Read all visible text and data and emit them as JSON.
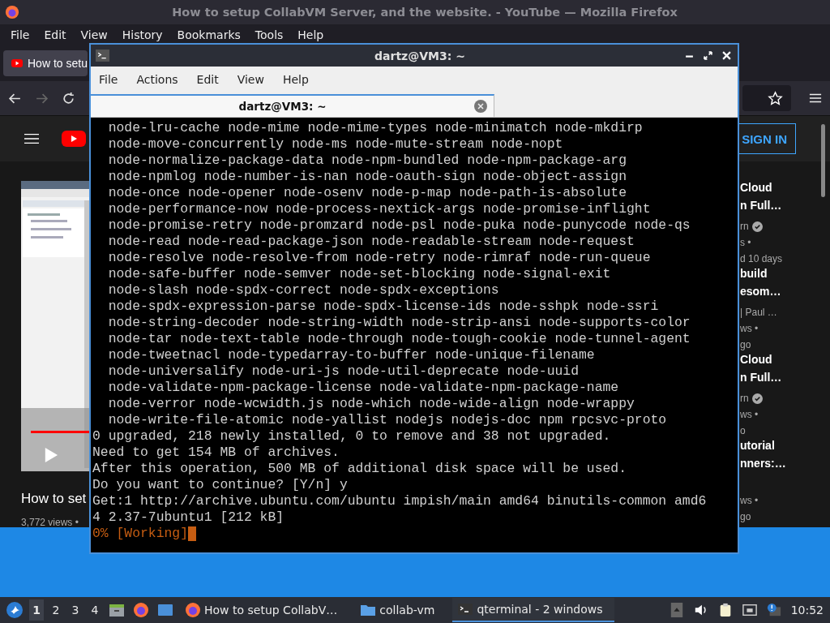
{
  "browser": {
    "title": "How to setup CollabVM Server, and the website. - YouTube — Mozilla Firefox",
    "menu": [
      "File",
      "Edit",
      "View",
      "History",
      "Bookmarks",
      "Tools",
      "Help"
    ],
    "tab": {
      "title": "How to setu"
    },
    "page": {
      "sign_in": "SIGN IN",
      "video": {
        "title": "How to set",
        "views": "3,772 views •",
        "level": 1
      },
      "related": [
        {
          "title": [
            "Cloud",
            "n Full…"
          ],
          "meta": [
            "rn",
            "s •",
            "d 10 days"
          ],
          "verified": true
        },
        {
          "title": [
            "build",
            "esom…"
          ],
          "meta": [
            "| Paul …",
            "ws •",
            "go"
          ],
          "verified": false
        },
        {
          "title": [
            "Cloud",
            "n Full…"
          ],
          "meta": [
            "rn",
            "ws •",
            "o"
          ],
          "verified": true
        },
        {
          "title": [
            "utorial",
            "nners:…"
          ],
          "meta": [
            "ws •",
            "go"
          ],
          "verified": false
        }
      ]
    }
  },
  "terminal": {
    "title": "dartz@VM3: ~",
    "menu": [
      "File",
      "Actions",
      "Edit",
      "View",
      "Help"
    ],
    "tab": {
      "title": "dartz@VM3: ~"
    },
    "lines": [
      {
        "kind": "text",
        "text": "  node-lru-cache node-mime node-mime-types node-minimatch node-mkdirp"
      },
      {
        "kind": "text",
        "text": "  node-move-concurrently node-ms node-mute-stream node-nopt"
      },
      {
        "kind": "text",
        "text": "  node-normalize-package-data node-npm-bundled node-npm-package-arg"
      },
      {
        "kind": "text",
        "text": "  node-npmlog node-number-is-nan node-oauth-sign node-object-assign"
      },
      {
        "kind": "text",
        "text": "  node-once node-opener node-osenv node-p-map node-path-is-absolute"
      },
      {
        "kind": "text",
        "text": "  node-performance-now node-process-nextick-args node-promise-inflight"
      },
      {
        "kind": "text",
        "text": "  node-promise-retry node-promzard node-psl node-puka node-punycode node-qs"
      },
      {
        "kind": "text",
        "text": "  node-read node-read-package-json node-readable-stream node-request"
      },
      {
        "kind": "text",
        "text": "  node-resolve node-resolve-from node-retry node-rimraf node-run-queue"
      },
      {
        "kind": "text",
        "text": "  node-safe-buffer node-semver node-set-blocking node-signal-exit"
      },
      {
        "kind": "text",
        "text": "  node-slash node-spdx-correct node-spdx-exceptions"
      },
      {
        "kind": "text",
        "text": "  node-spdx-expression-parse node-spdx-license-ids node-sshpk node-ssri"
      },
      {
        "kind": "text",
        "text": "  node-string-decoder node-string-width node-strip-ansi node-supports-color"
      },
      {
        "kind": "text",
        "text": "  node-tar node-text-table node-through node-tough-cookie node-tunnel-agent"
      },
      {
        "kind": "text",
        "text": "  node-tweetnacl node-typedarray-to-buffer node-unique-filename"
      },
      {
        "kind": "text",
        "text": "  node-universalify node-uri-js node-util-deprecate node-uuid"
      },
      {
        "kind": "text",
        "text": "  node-validate-npm-package-license node-validate-npm-package-name"
      },
      {
        "kind": "text",
        "text": "  node-verror node-wcwidth.js node-which node-wide-align node-wrappy"
      },
      {
        "kind": "text",
        "text": "  node-write-file-atomic node-yallist nodejs nodejs-doc npm rpcsvc-proto"
      },
      {
        "kind": "text",
        "text": "0 upgraded, 218 newly installed, 0 to remove and 38 not upgraded."
      },
      {
        "kind": "text",
        "text": "Need to get 154 MB of archives."
      },
      {
        "kind": "text",
        "text": "After this operation, 500 MB of additional disk space will be used."
      },
      {
        "kind": "text",
        "text": "Do you want to continue? [Y/n] y"
      },
      {
        "kind": "text",
        "text": "Get:1 http://archive.ubuntu.com/ubuntu impish/main amd64 binutils-common amd6"
      },
      {
        "kind": "text",
        "text": "4 2.37-7ubuntu1 [212 kB]"
      },
      {
        "kind": "progress",
        "text": "0% [Working]"
      }
    ]
  },
  "taskbar": {
    "workspaces": [
      {
        "label": "1",
        "selected": true
      },
      {
        "label": "2",
        "selected": false
      },
      {
        "label": "3",
        "selected": false
      },
      {
        "label": "4",
        "selected": false
      }
    ],
    "tasks": [
      {
        "kind": "firefox",
        "label": "How to setup CollabV…",
        "selected": false
      },
      {
        "kind": "folder",
        "label": "collab-vm",
        "selected": false
      },
      {
        "kind": "terminal",
        "label": "qterminal - 2 windows",
        "selected": true
      }
    ],
    "clock": "10:52"
  }
}
